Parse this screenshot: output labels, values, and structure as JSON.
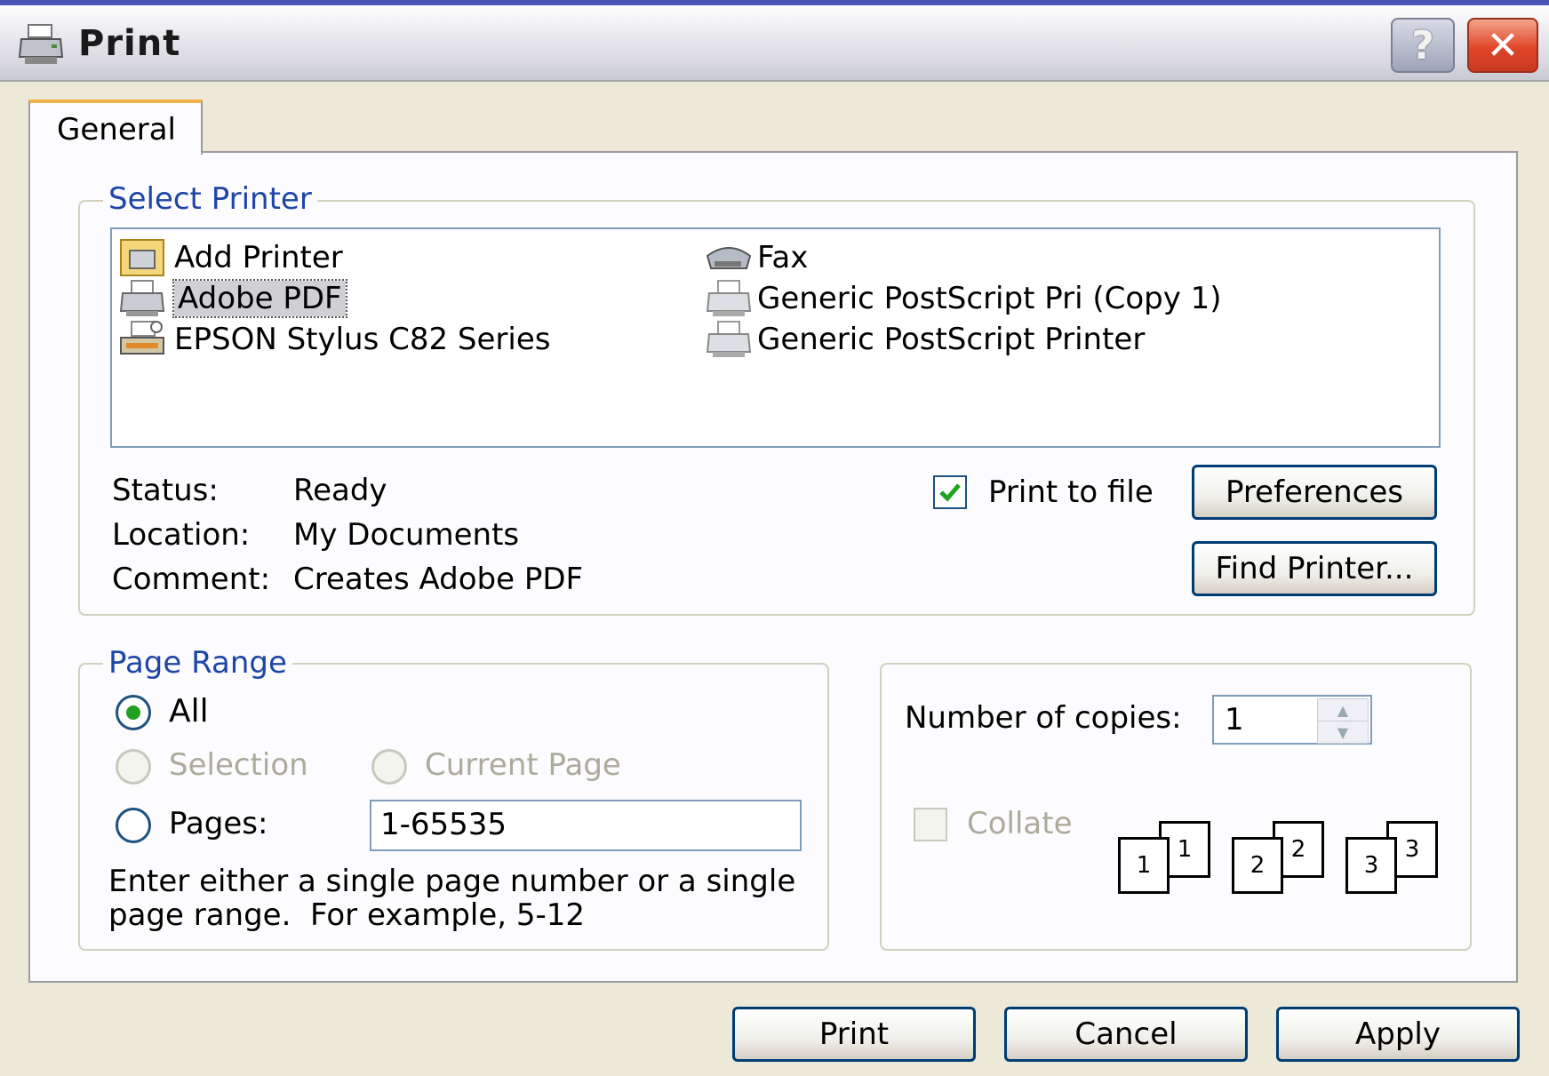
{
  "window": {
    "title": "Print",
    "help_label": "?",
    "close_label": "✕",
    "print_icon": "printer-icon"
  },
  "tabs": [
    {
      "label": "General"
    }
  ],
  "select_printer": {
    "title": "Select Printer",
    "printers": [
      {
        "label": "Add Printer",
        "icon": "add-printer-icon"
      },
      {
        "label": "Adobe PDF",
        "icon": "printer-icon",
        "selected": true
      },
      {
        "label": "EPSON Stylus C82 Series",
        "icon": "epson-printer-icon"
      },
      {
        "label": "Fax",
        "icon": "fax-icon"
      },
      {
        "label": "Generic PostScript Pri (Copy 1)",
        "icon": "printer-icon"
      },
      {
        "label": "Generic PostScript Printer",
        "icon": "printer-icon"
      }
    ],
    "status_label": "Status:",
    "status_value": "Ready",
    "location_label": "Location:",
    "location_value": "My Documents",
    "comment_label": "Comment:",
    "comment_value": "Creates Adobe PDF",
    "print_to_file": {
      "label": "Print to file",
      "checked": true
    },
    "preferences_label": "Preferences",
    "find_printer_label": "Find Printer..."
  },
  "page_range": {
    "title": "Page Range",
    "all_label": "All",
    "selection_label": "Selection",
    "current_page_label": "Current Page",
    "pages_label": "Pages:",
    "pages_value": "1-65535",
    "hint_line1": "Enter either a single page number or a single",
    "hint_line2": "page range.  For example, 5-12",
    "selected": "All"
  },
  "copies": {
    "label": "Number of copies:",
    "value": "1",
    "collate_label": "Collate",
    "collate_checked": false,
    "collate_pages": [
      "1",
      "1",
      "2",
      "2",
      "3",
      "3"
    ]
  },
  "footer": {
    "print_label": "Print",
    "cancel_label": "Cancel",
    "apply_label": "Apply"
  },
  "colors": {
    "group_title": "#1f45a8",
    "titlebar_border": "#4a57b8",
    "close_button": "#e0462a",
    "tab_highlight": "#f2b146",
    "button_border": "#003c74",
    "check_mark": "#21a121"
  }
}
